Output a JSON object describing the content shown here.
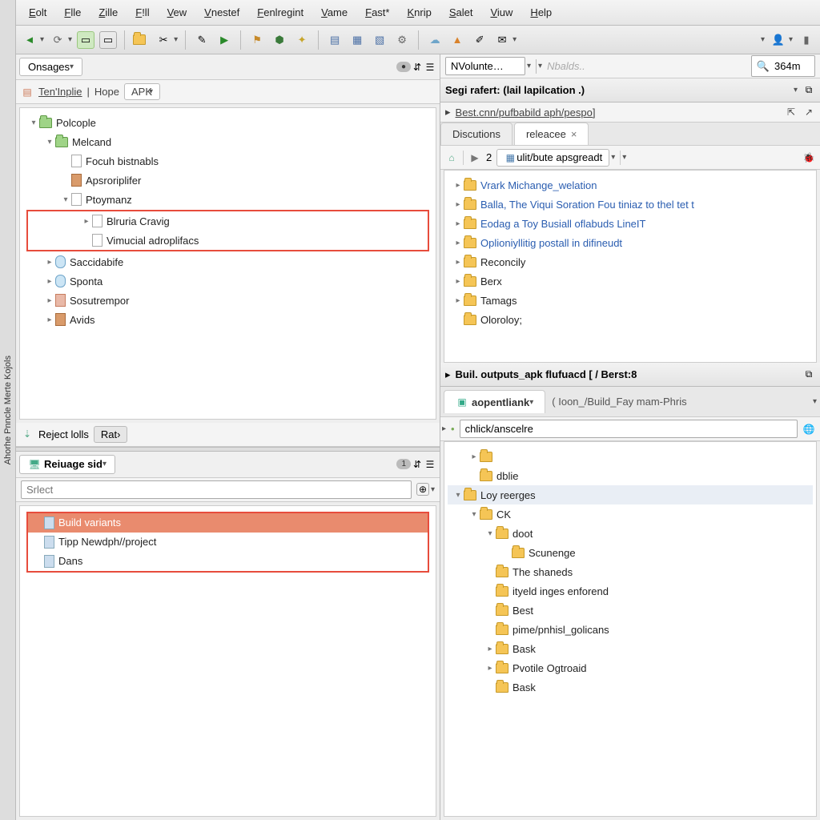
{
  "sidebar_vertical_text": "Ahorhe Pnncle  Merte Kojols",
  "menu": [
    "Eolt",
    "Flle",
    "Zille",
    "F!ll",
    "Vew",
    "Vnestef",
    "Fenlregint",
    "Vame",
    "Fast*",
    "Knrip",
    "Salet",
    "Viuw",
    "Help"
  ],
  "left": {
    "panel_tab": "Onsages",
    "breadcrumb": {
      "a": "Ten'Inplie",
      "b": "Hope",
      "apk": "APK"
    },
    "badge": "",
    "tree": [
      {
        "d": 0,
        "tw": "▾",
        "ic": "fg",
        "t": "Polcople"
      },
      {
        "d": 1,
        "tw": "▾",
        "ic": "fg",
        "t": "Melcand"
      },
      {
        "d": 2,
        "tw": "",
        "ic": "fi",
        "t": "Focuh bistnabls"
      },
      {
        "d": 2,
        "tw": "",
        "ic": "bx",
        "t": "Apsroriplifer"
      },
      {
        "d": 2,
        "tw": "▾",
        "ic": "fi",
        "t": "Ptoymanz"
      },
      {
        "d": 3,
        "tw": "▸",
        "ic": "fi",
        "t": "Blruria Cravig",
        "hl": true
      },
      {
        "d": 3,
        "tw": "",
        "ic": "fi",
        "t": "Vimucial adroplifacs",
        "hl": true
      },
      {
        "d": 1,
        "tw": "▸",
        "ic": "db",
        "t": "Saccidabife"
      },
      {
        "d": 1,
        "tw": "▸",
        "ic": "db",
        "t": "Sponta"
      },
      {
        "d": 1,
        "tw": "▸",
        "ic": "rd",
        "t": "Sosutrempor"
      },
      {
        "d": 1,
        "tw": "▸",
        "ic": "bx",
        "t": "Avids"
      }
    ],
    "reject": {
      "label": "Reject lolls",
      "btn": "Rat"
    },
    "reuage": {
      "label": "Reiuage sid",
      "badge": "1"
    },
    "select_placeholder": "Srlect",
    "list": [
      {
        "t": "Build variants",
        "hl": true,
        "row_hl": true
      },
      {
        "t": "Tipp Newdph//project",
        "hl": true
      },
      {
        "t": "Dans",
        "hl": true
      }
    ]
  },
  "right": {
    "topbar": {
      "combo": "NVolunte…",
      "ghost": "Nbalds..",
      "search": "364m"
    },
    "title": "Segi rafert: (lail lapilcation .)",
    "path": "Best.cnn/pufbabild aph/pespo]",
    "tabs": [
      {
        "t": "Discutions"
      },
      {
        "t": "releacee",
        "active": true,
        "close": true
      }
    ],
    "nav": {
      "num": "2",
      "combo": "ulit/bute apsgreadt"
    },
    "tree1": [
      {
        "d": 0,
        "tw": "▸",
        "t": "Vrark Michange_welation",
        "link": true
      },
      {
        "d": 0,
        "tw": "▸",
        "t": "Balla, The Viqui Soration Fou tiniaz to thel tet t",
        "link": true
      },
      {
        "d": 0,
        "tw": "▸",
        "t": "Eodag a Toy Busiall oflabuds LineIT",
        "link": true
      },
      {
        "d": 0,
        "tw": "▸",
        "t": "Oplioniyllitig postall in difineudt",
        "link": true
      },
      {
        "d": 0,
        "tw": "▸",
        "t": "Reconcily"
      },
      {
        "d": 0,
        "tw": "▸",
        "t": "Berx"
      },
      {
        "d": 0,
        "tw": "▸",
        "t": "Tamags"
      },
      {
        "d": 0,
        "tw": "",
        "t": "Oloroloy;"
      }
    ],
    "mid_title": "Buil. outputs_apk flufuacd [ /  Berst:8",
    "mid_tabs": {
      "a": "aopentliank",
      "b": "( Ioon_/Build_Fay mam-Phris"
    },
    "mid_input": "chlick/anscelre",
    "tree2": [
      {
        "d": 1,
        "tw": "▸",
        "t": ""
      },
      {
        "d": 1,
        "tw": "",
        "t": "dblie"
      },
      {
        "d": 0,
        "tw": "▾",
        "t": "Loy reerges"
      },
      {
        "d": 1,
        "tw": "▾",
        "t": "CK"
      },
      {
        "d": 2,
        "tw": "▾",
        "t": "doot"
      },
      {
        "d": 3,
        "tw": "",
        "t": "Scunenge"
      },
      {
        "d": 2,
        "tw": "",
        "t": "The shaneds"
      },
      {
        "d": 2,
        "tw": "",
        "t": "ityeld inges enforend"
      },
      {
        "d": 2,
        "tw": "",
        "t": "Best"
      },
      {
        "d": 2,
        "tw": "",
        "t": "pime/pnhisl_golicans"
      },
      {
        "d": 2,
        "tw": "▸",
        "t": "Bask"
      },
      {
        "d": 2,
        "tw": "▸",
        "t": "Pvotile Ogtroaid"
      },
      {
        "d": 2,
        "tw": "",
        "t": "Bask"
      }
    ]
  }
}
